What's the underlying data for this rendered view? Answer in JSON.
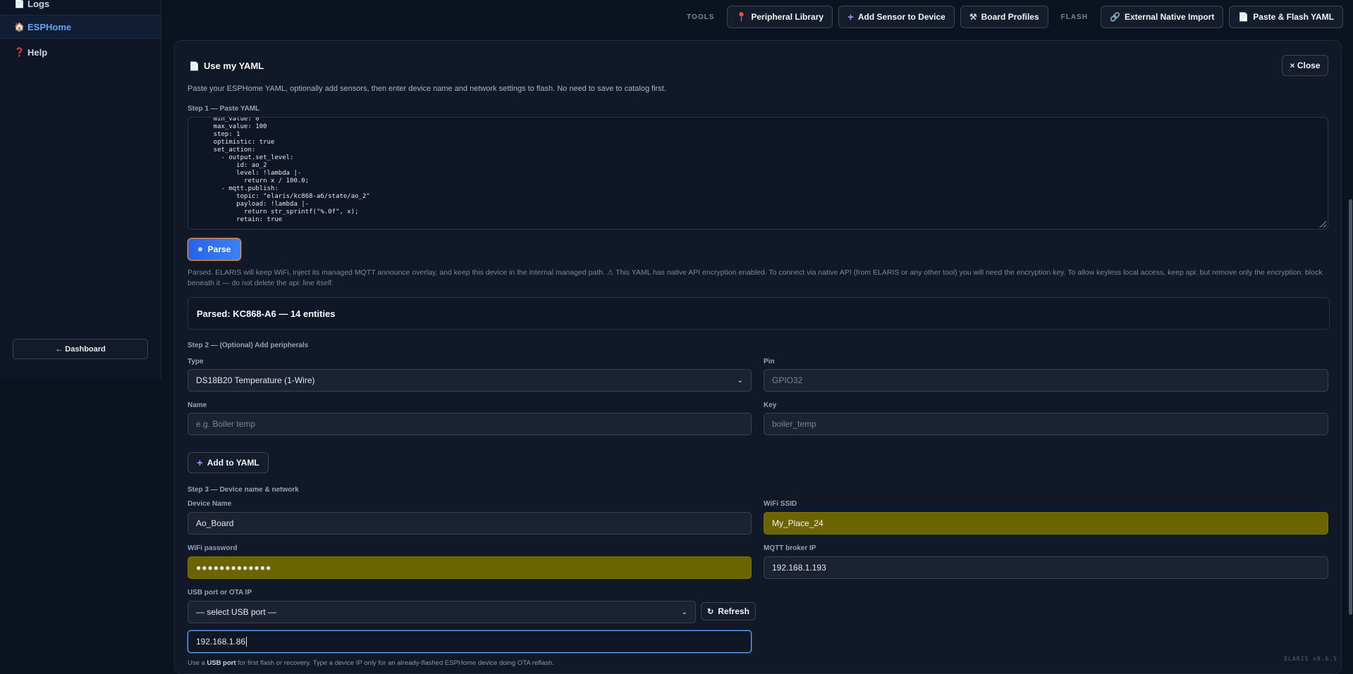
{
  "sidebar": {
    "items": [
      {
        "label": "Logs",
        "icon": "document-icon"
      },
      {
        "label": "ESPHome",
        "icon": "home-icon"
      },
      {
        "label": "Help",
        "icon": "question-icon"
      }
    ],
    "dashboard_label": "← Dashboard"
  },
  "toolbar": {
    "tools_label": "TOOLS",
    "flash_label": "FLASH",
    "peripheral_library": "Peripheral Library",
    "add_sensor": "Add Sensor to Device",
    "board_profiles": "Board Profiles",
    "external_import": "External Native Import",
    "paste_flash": "Paste & Flash YAML"
  },
  "panel": {
    "title": "Use my YAML",
    "close_label": "× Close",
    "intro": "Paste your ESPHome YAML, optionally add sensors, then enter device name and network settings to flash. No need to save to catalog first.",
    "step1": "Step 1 — Paste YAML",
    "yaml": "    min_value: 0\n    max_value: 100\n    step: 1\n    optimistic: true\n    set_action:\n      - output.set_level:\n          id: ao_2\n          level: !lambda |-\n            return x / 100.0;\n      - mqtt.publish:\n          topic: \"elaris/kc868-a6/state/ao_2\"\n          payload: !lambda |-\n            return str_sprintf(\"%.0f\", x);\n          retain: true",
    "parse_label": "Parse",
    "parsed_message": "Parsed. ELARIS will keep WiFi, inject its managed MQTT announce overlay, and keep this device in the internal managed path. ⚠ This YAML has native API encryption enabled. To connect via native API (from ELARIS or any other tool) you will need the encryption key. To allow keyless local access, keep api: but remove only the encryption: block beneath it — do not delete the api: line itself.",
    "parsed_summary": "Parsed: KC868-A6 — 14 entities",
    "step2": "Step 2 — (Optional) Add peripherals",
    "type_label": "Type",
    "type_value": "DS18B20 Temperature (1-Wire)",
    "pin_label": "Pin",
    "pin_placeholder": "GPIO32",
    "name_label": "Name",
    "name_placeholder": "e.g. Boiler temp",
    "key_label": "Key",
    "key_placeholder": "boiler_temp",
    "add_to_yaml": "Add to YAML",
    "step3": "Step 3 — Device name & network",
    "device_name_label": "Device Name",
    "device_name_value": "Ao_Board",
    "wifi_ssid_label": "WiFi SSID",
    "wifi_ssid_value": "My_Place_24",
    "wifi_password_label": "WiFi password",
    "wifi_password_value": "●●●●●●●●●●●●●",
    "mqtt_label": "MQTT broker IP",
    "mqtt_value": "192.168.1.193",
    "usb_label": "USB port or OTA IP",
    "usb_select": "— select USB port —",
    "refresh_label": "Refresh",
    "ota_ip_value": "192.168.1.86",
    "hint_prefix": "Use a ",
    "hint_bold": "USB port",
    "hint_suffix": " for first flash or recovery. Type a device IP only for an already-flashed ESPHome device doing OTA reflash."
  },
  "version": "ELARIS v0.6.5",
  "colors": {
    "background": "#0b1220",
    "accent": "#3b82f6",
    "autofill": "#6b6400"
  }
}
